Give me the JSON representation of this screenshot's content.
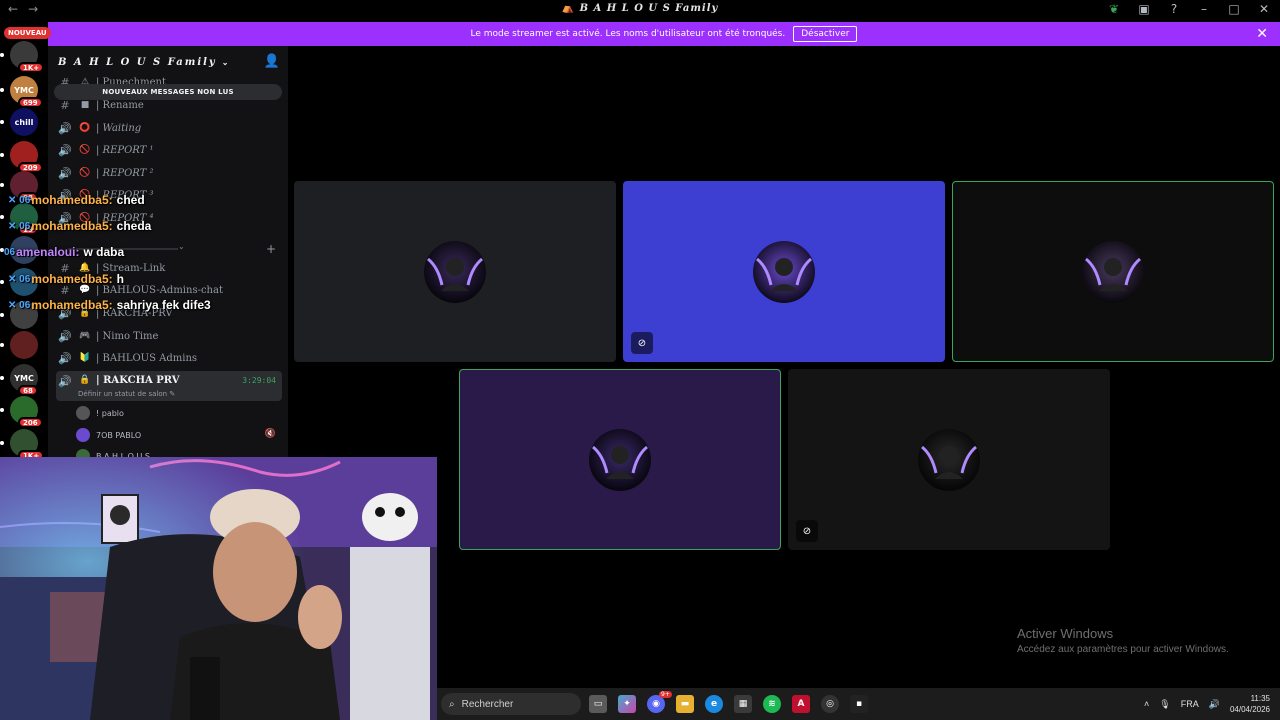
{
  "window": {
    "title": "B A H L O U S Family",
    "nav_back": "←",
    "nav_forward": "→"
  },
  "banner": {
    "text": "Le mode streamer est activé. Les noms d'utilisateur ont été tronqués.",
    "button": "Désactiver",
    "close": "✕"
  },
  "rail": {
    "new_label": "NOUVEAU",
    "servers": [
      {
        "label": "",
        "badge": "1K+",
        "color": "#3a3a3a"
      },
      {
        "label": "YMC",
        "badge": "699",
        "color": "#c08040"
      },
      {
        "label": "chill",
        "badge": "",
        "color": "#101060"
      },
      {
        "label": "",
        "badge": "209",
        "color": "#a02020"
      },
      {
        "label": "",
        "badge": "98",
        "color": "#602030"
      },
      {
        "label": "",
        "badge": "19",
        "color": "#206040"
      },
      {
        "label": "",
        "badge": "",
        "color": "#304060"
      },
      {
        "label": "",
        "badge": "",
        "color": "#205070"
      },
      {
        "label": "",
        "badge": "",
        "color": "#404040"
      },
      {
        "label": "",
        "badge": "",
        "color": "#602020"
      },
      {
        "label": "YMC",
        "badge": "68",
        "color": "#303030"
      },
      {
        "label": "",
        "badge": "206",
        "color": "#2a6a2a"
      },
      {
        "label": "",
        "badge": "1K+",
        "color": "#305030"
      }
    ]
  },
  "sidebar": {
    "server_name": "B A H L O U S Family",
    "unread_banner": "NOUVEAUX MESSAGES NON LUS",
    "channels": [
      {
        "icon": "#",
        "emoji": "⚠",
        "name": "| Punechment",
        "italic": false
      },
      {
        "icon": "#",
        "emoji": "■",
        "name": "| Rename",
        "italic": false
      },
      {
        "icon": "🔊",
        "emoji": "⭕",
        "name": "| Waiting",
        "italic": true
      },
      {
        "icon": "🔊",
        "emoji": "🚫",
        "name": "| REPORT ¹",
        "italic": true
      },
      {
        "icon": "🔊",
        "emoji": "🚫",
        "name": "| REPORT ²",
        "italic": true
      },
      {
        "icon": "🔊",
        "emoji": "🚫",
        "name": "| REPORT ³",
        "italic": true
      },
      {
        "icon": "🔊",
        "emoji": "🚫",
        "name": "| REPORT ⁴",
        "italic": true
      },
      {
        "icon": "#",
        "emoji": "🔔",
        "name": "| Stream-Link",
        "italic": false
      },
      {
        "icon": "#",
        "emoji": "💬",
        "name": "| BAHLOUS-Admins-chat",
        "italic": false
      },
      {
        "icon": "🔊",
        "emoji": "🔒",
        "name": "| RAKCHA-PRV",
        "italic": false
      },
      {
        "icon": "🔊",
        "emoji": "🎮",
        "name": "| Nimo Time",
        "italic": false
      },
      {
        "icon": "🔊",
        "emoji": "🔰",
        "name": "| BAHLOUS Admins",
        "italic": false
      }
    ],
    "active_channel": {
      "name": "| RAKCHA PRV",
      "timer": "3:29:04",
      "status": "Définir un statut de salon ✎"
    },
    "members": [
      {
        "name": "! pablo",
        "color": "#555"
      },
      {
        "name": "7OB PABLO",
        "color": "#6a4ad0"
      },
      {
        "name": "B A H L O U S",
        "color": "#3a6a3a"
      }
    ]
  },
  "chat": [
    {
      "tag": "✕ 06",
      "user": "mohamedba5:",
      "msg": "ched",
      "user_color": "orange"
    },
    {
      "tag": "✕ 06",
      "user": "mohamedba5:",
      "msg": "cheda",
      "user_color": "orange"
    },
    {
      "tag": "06",
      "user": "amenaloui:",
      "msg": "w daba",
      "user_color": "purple"
    },
    {
      "tag": "✕ 06",
      "user": "mohamedba5:",
      "msg": "h",
      "user_color": "orange"
    },
    {
      "tag": "✕ 06",
      "user": "mohamedba5:",
      "msg": "sahriya fek dife3",
      "user_color": "orange"
    }
  ],
  "voice_tiles": [
    {
      "name": "tile-1",
      "bg": "#1e1f22",
      "speaking": false,
      "cam_off": false,
      "avatar_color": "#3a2a5a"
    },
    {
      "name": "tile-2",
      "bg": "#3c3fd1",
      "speaking": false,
      "cam_off": true,
      "avatar_color": "#6a4ad0"
    },
    {
      "name": "tile-3",
      "bg": "#0d0d0d",
      "speaking": true,
      "cam_off": false,
      "avatar_color": "#4a3a60"
    },
    {
      "name": "tile-4",
      "bg": "#2a1a4a",
      "speaking": true,
      "cam_off": false,
      "avatar_color": "#3a2a6a"
    },
    {
      "name": "tile-5",
      "bg": "#141414",
      "speaking": false,
      "cam_off": true,
      "avatar_color": "#2a2a2a"
    }
  ],
  "watermark": {
    "title": "Activer Windows",
    "subtitle": "Accédez aux paramètres pour activer Windows."
  },
  "taskbar": {
    "search_placeholder": "Rechercher",
    "lang": "FRA",
    "time": "11:35",
    "date": "04/04/2026",
    "chat_badge": "9+"
  },
  "colors": {
    "accent": "#9b30ff",
    "speaking": "#3ba55d",
    "badge": "#e03131"
  }
}
